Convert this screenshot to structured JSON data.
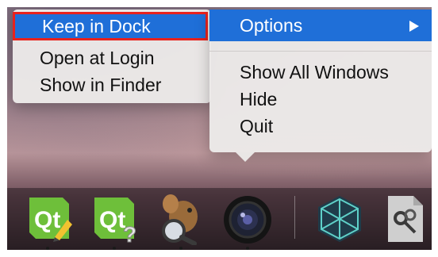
{
  "submenu": {
    "items": [
      {
        "label": "Keep in Dock",
        "selected": true
      },
      {
        "label": "Open at Login"
      },
      {
        "label": "Show in Finder"
      }
    ]
  },
  "mainmenu": {
    "options_label": "Options",
    "items": [
      {
        "label": "Show All Windows"
      },
      {
        "label": "Hide"
      },
      {
        "label": "Quit"
      }
    ]
  },
  "dock": {
    "apps": [
      {
        "icon": "qt-creator-icon"
      },
      {
        "icon": "qt-assistant-icon"
      },
      {
        "icon": "squirrel-magnifier-icon"
      },
      {
        "icon": "camera-lens-icon"
      },
      {
        "icon": "polyhedron-app-icon"
      },
      {
        "icon": "script-editor-icon"
      }
    ]
  },
  "colors": {
    "selection_blue": "#1f6fd8",
    "highlight_red": "#e8221d",
    "qt_green": "#6ebf3a"
  }
}
